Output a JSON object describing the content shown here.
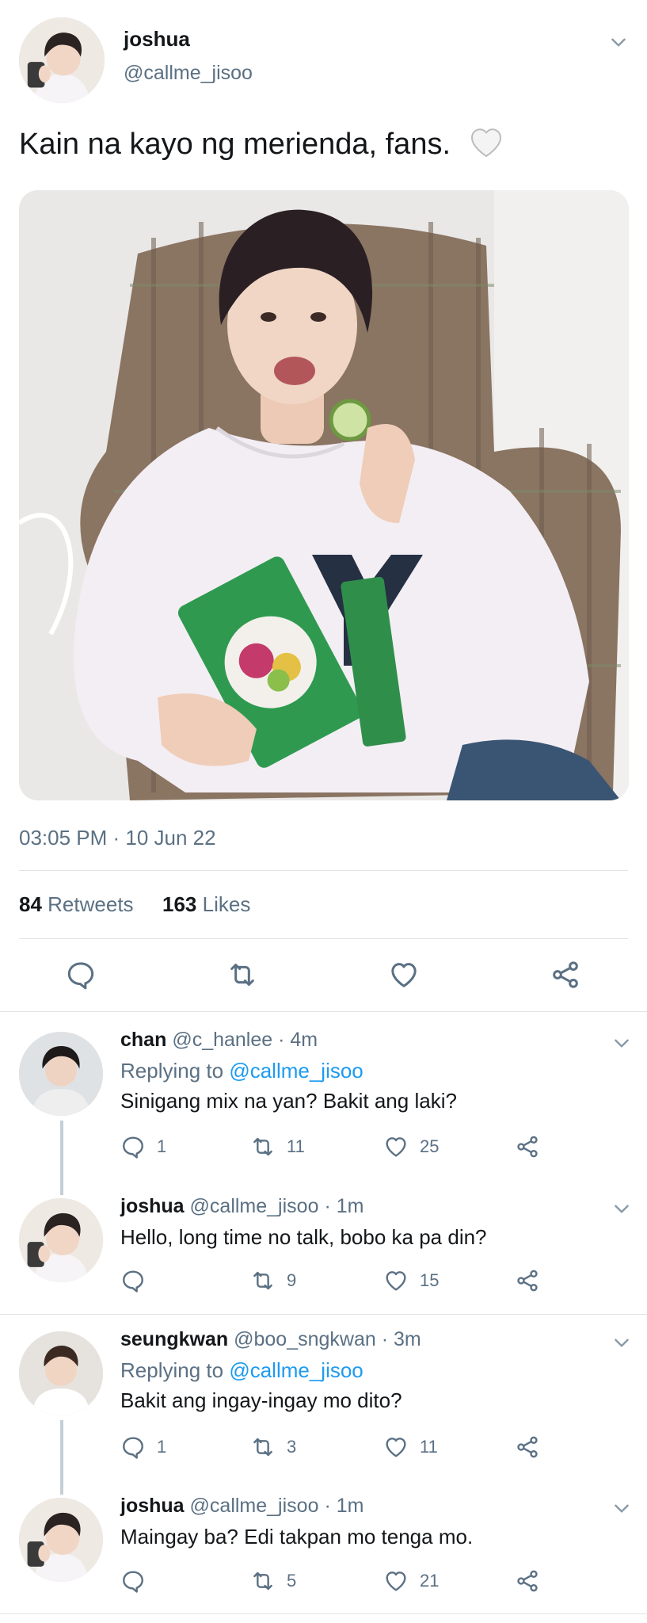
{
  "main_tweet": {
    "name": "joshua",
    "handle": "@callme_jisoo",
    "text": "Kain na kayo ng merienda, fans.",
    "timestamp": "03:05 PM · 10 Jun 22",
    "retweets_count": "84",
    "retweets_label": "Retweets",
    "likes_count": "163",
    "likes_label": "Likes"
  },
  "replies": [
    {
      "name": "chan",
      "handle": "@c_hanlee",
      "time": "· 4m",
      "replying_prefix": "Replying to",
      "replying_to": "@callme_jisoo",
      "text": "Sinigang mix na yan? Bakit ang laki?",
      "comments": "1",
      "retweets": "11",
      "likes": "25"
    },
    {
      "name": "joshua",
      "handle": "@callme_jisoo",
      "time": "· 1m",
      "text": "Hello, long time no talk, bobo ka pa din?",
      "comments": "",
      "retweets": "9",
      "likes": "15"
    },
    {
      "name": "seungkwan",
      "handle": "@boo_sngkwan",
      "time": "· 3m",
      "replying_prefix": "Replying to",
      "replying_to": "@callme_jisoo",
      "text": "Bakit ang ingay-ingay mo dito?",
      "comments": "1",
      "retweets": "3",
      "likes": "11"
    },
    {
      "name": "joshua",
      "handle": "@callme_jisoo",
      "time": "· 1m",
      "text": "Maingay ba? Edi takpan mo tenga mo.",
      "comments": "",
      "retweets": "5",
      "likes": "21"
    }
  ],
  "colors": {
    "link": "#1d9bf0",
    "muted": "#5b7083",
    "divider": "#dfe3e6"
  },
  "icons": [
    "chevron-down-icon",
    "comment-icon",
    "retweet-icon",
    "heart-icon",
    "share-icon"
  ]
}
